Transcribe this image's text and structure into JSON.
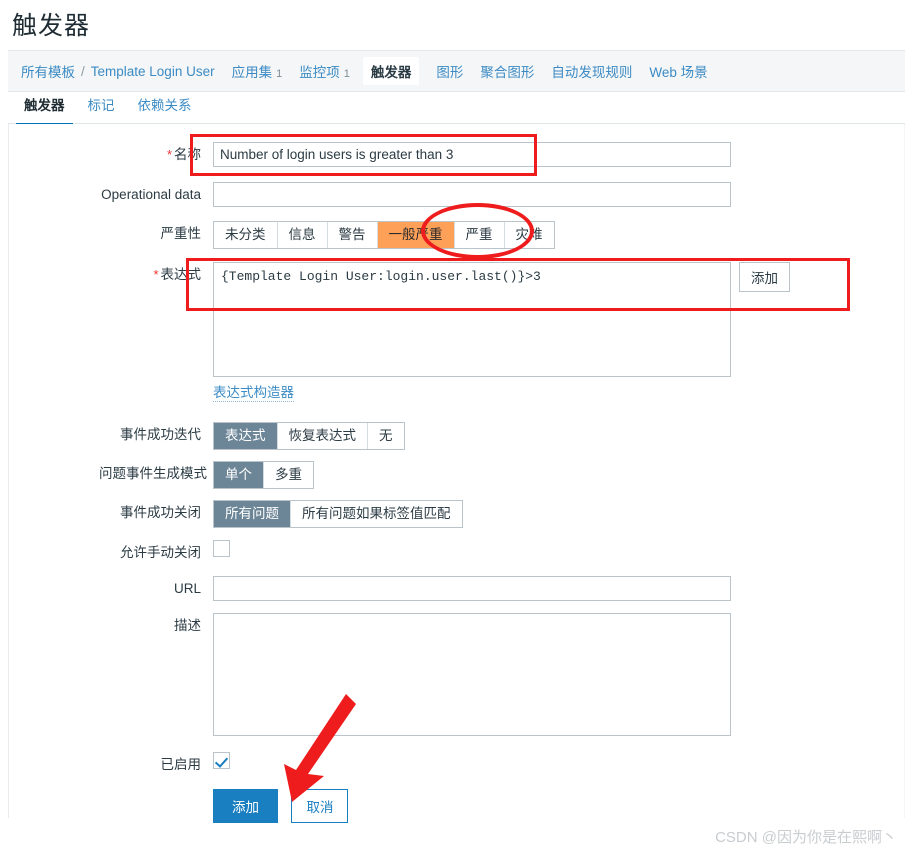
{
  "page": {
    "title": "触发器"
  },
  "breadcrumb": {
    "root": "所有模板",
    "separator": "/",
    "template": "Template Login User",
    "tabs": [
      {
        "label": "应用集",
        "count": "1",
        "selected": false
      },
      {
        "label": "监控项",
        "count": "1",
        "selected": false
      },
      {
        "label": "触发器",
        "count": "",
        "selected": true
      },
      {
        "label": "图形",
        "count": "",
        "selected": false
      },
      {
        "label": "聚合图形",
        "count": "",
        "selected": false
      },
      {
        "label": "自动发现规则",
        "count": "",
        "selected": false
      },
      {
        "label": "Web 场景",
        "count": "",
        "selected": false
      }
    ]
  },
  "subtabs": [
    {
      "label": "触发器",
      "active": true
    },
    {
      "label": "标记",
      "active": false
    },
    {
      "label": "依赖关系",
      "active": false
    }
  ],
  "form": {
    "name": {
      "label": "名称",
      "required": "*",
      "value": "Number of login users is greater than 3"
    },
    "operational_data": {
      "label": "Operational data",
      "value": "",
      "placeholder": ""
    },
    "severity": {
      "label": "严重性",
      "options": [
        "未分类",
        "信息",
        "警告",
        "一般严重",
        "严重",
        "灾难"
      ],
      "selected": "一般严重",
      "selected_color": "#ffa059"
    },
    "expression": {
      "label": "表达式",
      "required": "*",
      "value": "{Template Login User:login.user.last()}>3",
      "add_button": "添加",
      "constructor_link": "表达式构造器"
    },
    "recovery_mode": {
      "label": "事件成功迭代",
      "options": [
        "表达式",
        "恢复表达式",
        "无"
      ],
      "selected": "表达式"
    },
    "problem_event_generation": {
      "label": "问题事件生成模式",
      "options": [
        "单个",
        "多重"
      ],
      "selected": "单个"
    },
    "ok_event_closes": {
      "label": "事件成功关闭",
      "options": [
        "所有问题",
        "所有问题如果标签值匹配"
      ],
      "selected": "所有问题"
    },
    "allow_manual_close": {
      "label": "允许手动关闭",
      "checked": false
    },
    "url": {
      "label": "URL",
      "value": ""
    },
    "description": {
      "label": "描述",
      "value": ""
    },
    "enabled": {
      "label": "已启用",
      "checked": true
    },
    "actions": {
      "submit": "添加",
      "cancel": "取消"
    }
  },
  "watermark": "CSDN @因为你是在熙啊丶",
  "colors": {
    "accent_blue": "#1a7fc1",
    "link_blue": "#3c8bc4",
    "selected_grey": "#6d8697",
    "severity_average": "#ffa059",
    "annotation_red": "#ee1c1c"
  }
}
